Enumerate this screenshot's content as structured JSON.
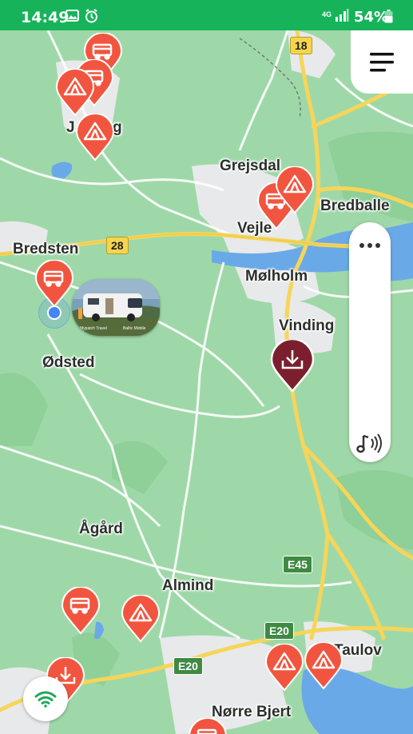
{
  "status_bar": {
    "time": "14:49",
    "network": "4G",
    "battery": "54%"
  },
  "map": {
    "places": {
      "grejsdal": "Grejsdal",
      "bredballe": "Bredballe",
      "vejle": "Vejle",
      "bredsten": "Bredsten",
      "molholm": "Mølholm",
      "vinding": "Vinding",
      "odsted": "Ødsted",
      "agard": "Ågård",
      "almind": "Almind",
      "taulov": "Taulov",
      "norre_bjert": "Nørre Bjert",
      "jelling_partial": "J",
      "jelling_partial_end": "g"
    },
    "road_shields": {
      "r18": "18",
      "r28": "28",
      "e45": "E45",
      "e20_a": "E20",
      "e20_b": "E20"
    },
    "photo_caption_left": "Mypatch Travel",
    "photo_caption_right": "Baltic Mobile"
  },
  "colors": {
    "status_bar": "#17b35a",
    "map_land": "#9fd8a8",
    "pin_orange": "#f2553f",
    "pin_selected": "#7b1f2e",
    "road_yellow": "#f6d55a",
    "water": "#6aa9e8",
    "urban": "#e8e9ea"
  },
  "icons": {
    "menu": "hamburger-menu-icon",
    "more": "more-dots-icon",
    "sound": "sound-icon",
    "wifi": "wifi-icon",
    "camper": "camper-icon",
    "tent": "tent-icon",
    "download": "download-icon"
  }
}
